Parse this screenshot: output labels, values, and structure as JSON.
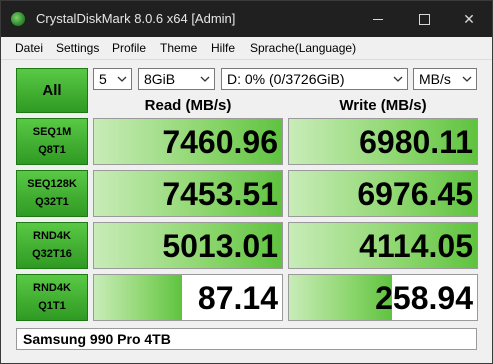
{
  "window": {
    "title": "CrystalDiskMark 8.0.6 x64 [Admin]",
    "controls": {
      "minimize_icon": "minimize-icon",
      "maximize_icon": "maximize-icon",
      "close_glyph": "✕"
    }
  },
  "menu": {
    "items": [
      "Datei",
      "Settings",
      "Profile",
      "Theme",
      "Hilfe",
      "Sprache(Language)"
    ]
  },
  "toolbar": {
    "all_label": "All",
    "count": "5",
    "size": "8GiB",
    "drive": "D: 0% (0/3726GiB)",
    "unit": "MB/s"
  },
  "headers": {
    "read": "Read (MB/s)",
    "write": "Write (MB/s)"
  },
  "tests": [
    {
      "line1": "SEQ1M",
      "line2": "Q8T1",
      "read": "7460.96",
      "write": "6980.11",
      "read_fill": 1.0,
      "write_fill": 1.0
    },
    {
      "line1": "SEQ128K",
      "line2": "Q32T1",
      "read": "7453.51",
      "write": "6976.45",
      "read_fill": 1.0,
      "write_fill": 1.0
    },
    {
      "line1": "RND4K",
      "line2": "Q32T16",
      "read": "5013.01",
      "write": "4114.05",
      "read_fill": 1.0,
      "write_fill": 1.0
    },
    {
      "line1": "RND4K",
      "line2": "Q1T1",
      "read": "87.14",
      "write": "258.94",
      "read_fill": 0.47,
      "write_fill": 0.55
    }
  ],
  "comment": "Samsung 990 Pro 4TB",
  "colors": {
    "accent_green": "#2f9a23",
    "titlebar": "#202020"
  }
}
